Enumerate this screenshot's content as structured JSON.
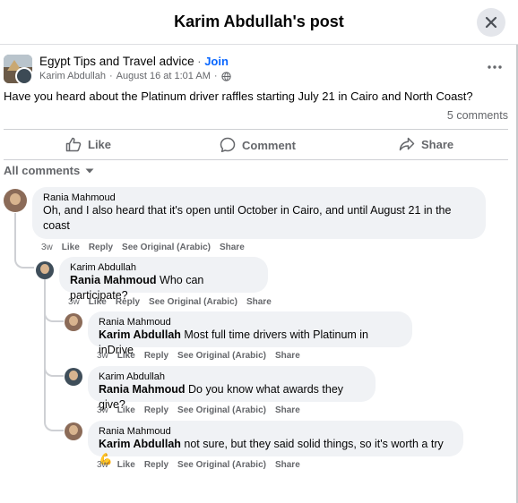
{
  "header": {
    "title": "Karim Abdullah's post"
  },
  "post": {
    "group_name": "Egypt Tips and Travel advice",
    "separator": "·",
    "join_label": "Join",
    "author": "Karim Abdullah",
    "date": "August 16 at 1:01 AM",
    "text": "Have you heard about the Platinum driver raffles starting July 21 in Cairo and North Coast?",
    "comment_count": "5 comments"
  },
  "actions": {
    "like": "Like",
    "comment": "Comment",
    "share": "Share"
  },
  "sort": {
    "label": "All comments"
  },
  "comments": [
    {
      "author": "Rania Mahmoud",
      "mention": "",
      "text": "Oh, and I also heard that it's open until October in Cairo, and until August 21 in the",
      "text_line2": "coast",
      "time": "3w",
      "like": "Like",
      "reply": "Reply",
      "see_original": "See Original (Arabic)",
      "share": "Share"
    },
    {
      "author": "Karim Abdullah",
      "mention": "Rania Mahmoud",
      "text": " Who can participate?",
      "time": "3w",
      "like": "Like",
      "reply": "Reply",
      "see_original": "See Original (Arabic)",
      "share": "Share"
    },
    {
      "author": "Rania Mahmoud",
      "mention": "Karim Abdullah",
      "text": " Most full time drivers with Platinum in inDrive",
      "time": "3w",
      "like": "Like",
      "reply": "Reply",
      "see_original": "See Original (Arabic)",
      "share": "Share"
    },
    {
      "author": "Karim Abdullah",
      "mention": "Rania Mahmoud",
      "text": " Do you know what awards they give?",
      "time": "3w",
      "like": "Like",
      "reply": "Reply",
      "see_original": "See Original (Arabic)",
      "share": "Share"
    },
    {
      "author": "Rania Mahmoud",
      "mention": "Karim Abdullah",
      "text": " not sure, but they said solid things, so it's worth a try",
      "emoji": "💪",
      "time": "3w",
      "like": "Like",
      "reply": "Reply",
      "see_original": "See Original (Arabic)",
      "share": "Share"
    }
  ],
  "colors": {
    "link": "#0866ff",
    "muted": "#65676b",
    "bubble": "#f0f2f5"
  },
  "icons": [
    "close-icon",
    "globe-icon",
    "more-icon",
    "like-icon",
    "comment-icon",
    "share-icon",
    "caret-down-icon"
  ]
}
